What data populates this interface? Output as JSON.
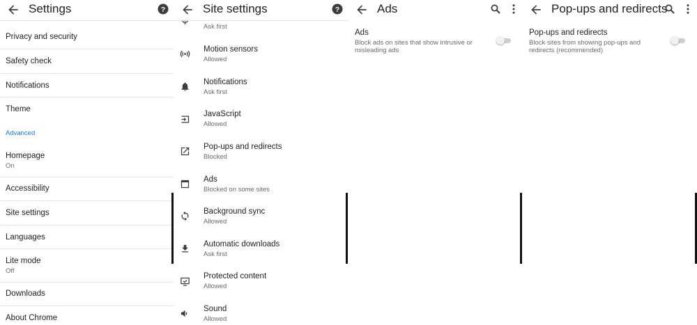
{
  "settings": {
    "title": "Settings",
    "items": [
      {
        "label": "Privacy and security"
      },
      {
        "label": "Safety check"
      },
      {
        "label": "Notifications"
      },
      {
        "label": "Theme"
      }
    ],
    "section_advanced": "Advanced",
    "advanced_items": [
      {
        "label": "Homepage",
        "sub": "On"
      },
      {
        "label": "Accessibility"
      },
      {
        "label": "Site settings"
      },
      {
        "label": "Languages"
      },
      {
        "label": "Lite mode",
        "sub": "Off"
      },
      {
        "label": "Downloads"
      },
      {
        "label": "About Chrome"
      }
    ]
  },
  "site_settings": {
    "title": "Site settings",
    "partial_top_sub": "Ask first",
    "items": [
      {
        "label": "Motion sensors",
        "sub": "Allowed",
        "icon": "motion-sensors-icon"
      },
      {
        "label": "Notifications",
        "sub": "Ask first",
        "icon": "bell-icon"
      },
      {
        "label": "JavaScript",
        "sub": "Allowed",
        "icon": "javascript-icon"
      },
      {
        "label": "Pop-ups and redirects",
        "sub": "Blocked",
        "icon": "open-in-new-icon"
      },
      {
        "label": "Ads",
        "sub": "Blocked on some sites",
        "icon": "ads-window-icon"
      },
      {
        "label": "Background sync",
        "sub": "Allowed",
        "icon": "sync-icon"
      },
      {
        "label": "Automatic downloads",
        "sub": "Ask first",
        "icon": "download-icon"
      },
      {
        "label": "Protected content",
        "sub": "Allowed",
        "icon": "protected-content-icon"
      },
      {
        "label": "Sound",
        "sub": "Allowed",
        "icon": "volume-icon"
      }
    ]
  },
  "ads": {
    "title": "Ads",
    "setting_label": "Ads",
    "setting_desc": "Block ads on sites that show intrusive or misleading ads",
    "toggle_on": false
  },
  "popups": {
    "title": "Pop-ups and redirects",
    "setting_label": "Pop-ups and redirects",
    "setting_desc": "Block sites from showing pop-ups and redirects (recommended)",
    "toggle_on": false
  },
  "colors": {
    "accent": "#1a73e8",
    "text": "#202124",
    "secondary_text": "#6b6b6b"
  }
}
